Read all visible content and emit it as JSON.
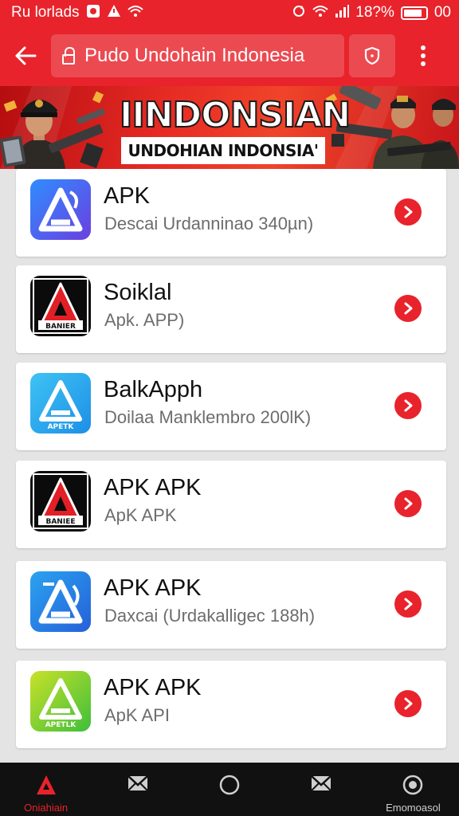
{
  "status_bar": {
    "left_text": "Ru lorlads",
    "battery_text": "18?%",
    "time": "00",
    "battery_level": 0.85
  },
  "address_bar": {
    "url": "Pudo Undohain Indonesia",
    "icons": {
      "back": "back-arrow-icon",
      "lock": "lock-icon",
      "shield": "shield-icon",
      "menu": "more-vert-icon"
    }
  },
  "banner": {
    "title": "IINDONSIAN",
    "subtitle": "UNDOHIAN INDONSIA'"
  },
  "apps": [
    {
      "name": "APK",
      "desc": "Descai Urdanninao 340µn)",
      "icon_style": "blue-grad",
      "icon_text": ""
    },
    {
      "name": "Soiklal",
      "desc": "Apk. APP)",
      "icon_style": "black-red",
      "icon_text": "BANIER"
    },
    {
      "name": "BalkApph",
      "desc": "Doilaa Manklembro 200lK)",
      "icon_style": "cyan",
      "icon_text": "APETK"
    },
    {
      "name": "APK APK",
      "desc": "ApK APK",
      "icon_style": "black-red",
      "icon_text": "BANIEE"
    },
    {
      "name": "APK APK",
      "desc": "Daxcai (Urdakalligec 188h)",
      "icon_style": "blue-mid",
      "icon_text": ""
    },
    {
      "name": "APK APK",
      "desc": "ApK API",
      "icon_style": "green",
      "icon_text": "APETLK"
    }
  ],
  "bottom_nav": [
    {
      "label": "Oniahiain",
      "icon": "app-logo-icon",
      "active": true
    },
    {
      "label": "",
      "icon": "mail-icon",
      "active": false
    },
    {
      "label": "",
      "icon": "home-circle-icon",
      "active": false
    },
    {
      "label": "",
      "icon": "mail-icon",
      "active": false
    },
    {
      "label": "Emomoasol",
      "icon": "target-icon",
      "active": false
    }
  ],
  "colors": {
    "accent": "#e8232b",
    "nav_bg": "#111111",
    "nav_active": "#e8232b",
    "nav_inactive": "#cfcfcf"
  }
}
